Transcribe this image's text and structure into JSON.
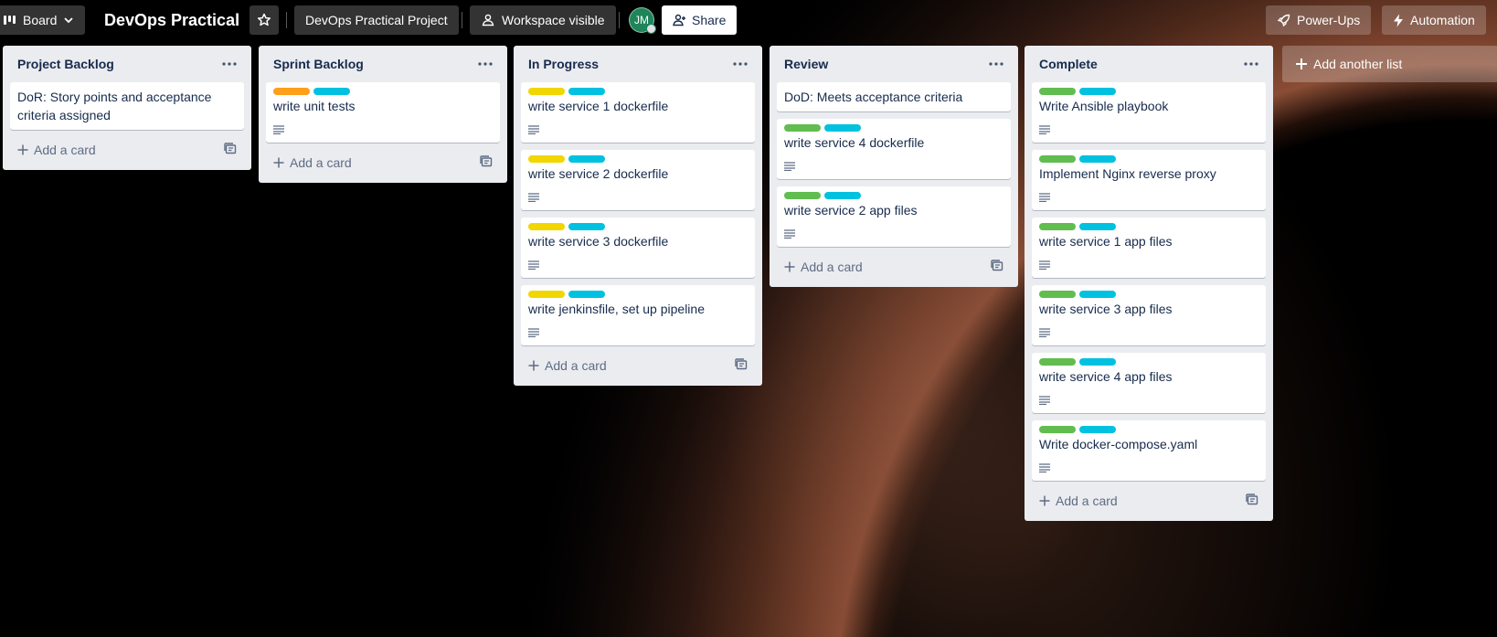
{
  "topbar": {
    "view_label": "Board",
    "board_title": "DevOps Practical",
    "workspace_label": "DevOps Practical Project",
    "visibility_label": "Workspace visible",
    "avatar_initials": "JM",
    "share_label": "Share",
    "powerups_label": "Power-Ups",
    "automation_label": "Automation"
  },
  "colors": {
    "label_orange": "#ff9f1a",
    "label_cyan": "#00c2e0",
    "label_yellow": "#f2d600",
    "label_green": "#61bd4f",
    "avatar_green": "#1f845a"
  },
  "lists": [
    {
      "title": "Project Backlog",
      "cards": [
        {
          "title": "DoR: Story points and acceptance criteria assigned",
          "labels": [],
          "has_description": false
        }
      ],
      "add_card_label": "Add a card"
    },
    {
      "title": "Sprint Backlog",
      "cards": [
        {
          "title": "write unit tests",
          "labels": [
            "orange",
            "cyan"
          ],
          "has_description": true
        }
      ],
      "add_card_label": "Add a card"
    },
    {
      "title": "In Progress",
      "cards": [
        {
          "title": "write service 1 dockerfile",
          "labels": [
            "yellow",
            "cyan"
          ],
          "has_description": true
        },
        {
          "title": "write service 2 dockerfile",
          "labels": [
            "yellow",
            "cyan"
          ],
          "has_description": true
        },
        {
          "title": "write service 3 dockerfile",
          "labels": [
            "yellow",
            "cyan"
          ],
          "has_description": true
        },
        {
          "title": "write jenkinsfile, set up pipeline",
          "labels": [
            "yellow",
            "cyan"
          ],
          "has_description": true
        }
      ],
      "add_card_label": "Add a card"
    },
    {
      "title": "Review",
      "cards": [
        {
          "title": "DoD: Meets acceptance criteria",
          "labels": [],
          "has_description": false
        },
        {
          "title": "write service 4 dockerfile",
          "labels": [
            "green",
            "cyan"
          ],
          "has_description": true
        },
        {
          "title": "write service 2 app files",
          "labels": [
            "green",
            "cyan"
          ],
          "has_description": true
        }
      ],
      "add_card_label": "Add a card"
    },
    {
      "title": "Complete",
      "cards": [
        {
          "title": "Write Ansible playbook",
          "labels": [
            "green",
            "cyan"
          ],
          "has_description": true
        },
        {
          "title": "Implement Nginx reverse proxy",
          "labels": [
            "green",
            "cyan"
          ],
          "has_description": true
        },
        {
          "title": "write service 1 app files",
          "labels": [
            "green",
            "cyan"
          ],
          "has_description": true
        },
        {
          "title": "write service 3 app files",
          "labels": [
            "green",
            "cyan"
          ],
          "has_description": true
        },
        {
          "title": "write service 4 app files",
          "labels": [
            "green",
            "cyan"
          ],
          "has_description": true
        },
        {
          "title": "Write docker-compose.yaml",
          "labels": [
            "green",
            "cyan"
          ],
          "has_description": true
        }
      ],
      "add_card_label": "Add a card"
    }
  ],
  "add_list_label": "Add another list"
}
